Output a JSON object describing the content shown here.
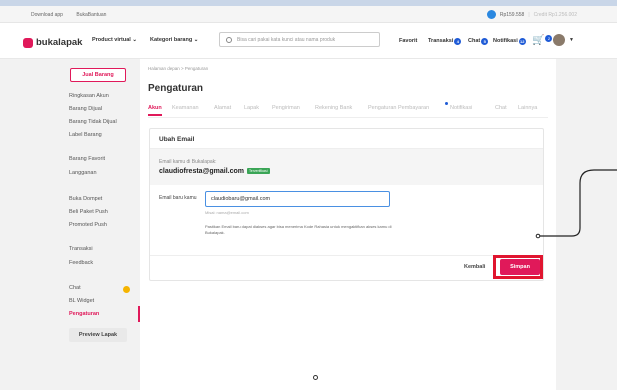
{
  "topbar": {
    "download": "Download app",
    "help": "BukaBantuan",
    "balance": "Rp159.558",
    "credit": "Credit Rp1.256.002"
  },
  "header": {
    "logo": "bukalapak",
    "product_virtual": "Product virtual",
    "kategori": "Kategori barang",
    "search_placeholder": "Bisa cari pakai kata kunci atau nama produk",
    "favorit": "Favorit",
    "transaksi": "Transaksi",
    "transaksi_badge": "4",
    "chat": "Chat",
    "chat_badge": "5",
    "notifikasi": "Notifikasi",
    "notifikasi_badge": "12",
    "cart_badge": "2"
  },
  "sidebar": {
    "jual": "Jual Barang",
    "items": [
      "Ringkasan Akun",
      "Barang Dijual",
      "Barang Tidak Dijual",
      "Label Barang",
      "Barang Favorit",
      "Langganan",
      "Buka Dompet",
      "Beli Paket Push",
      "Promoted Push",
      "Transaksi",
      "Feedback",
      "Chat",
      "BL Widget",
      "Pengaturan"
    ],
    "preview": "Preview Lapak"
  },
  "content": {
    "breadcrumb": "Halaman depan  >  Pengaturan",
    "title": "Pengaturan",
    "tabs": [
      "Akun",
      "Keamanan",
      "Alamat",
      "Lapak",
      "Pengiriman",
      "Rekening Bank",
      "Pengaturan Pembayaran",
      "Notifikasi",
      "Chat",
      "Lainnya"
    ]
  },
  "card": {
    "title": "Ubah Email",
    "current_label": "Email kamu di Bukalapak:",
    "current_email": "claudiofresta@gmail.com",
    "verified": "Terverifikasi",
    "new_label": "Email baru kamu",
    "new_value": "claudiobaru@gmail.com",
    "hint": "Misal: nama@email.com",
    "note": "Pastikan Email baru dapat diakses agar bisa menerima Kode Rahasia untuk mengaktifkan akses kamu di Bukalapak.",
    "back": "Kembali",
    "save": "Simpan"
  },
  "colors": {
    "brand": "#e0195a",
    "highlight": "#e0152f",
    "link": "#1f5bd6"
  }
}
